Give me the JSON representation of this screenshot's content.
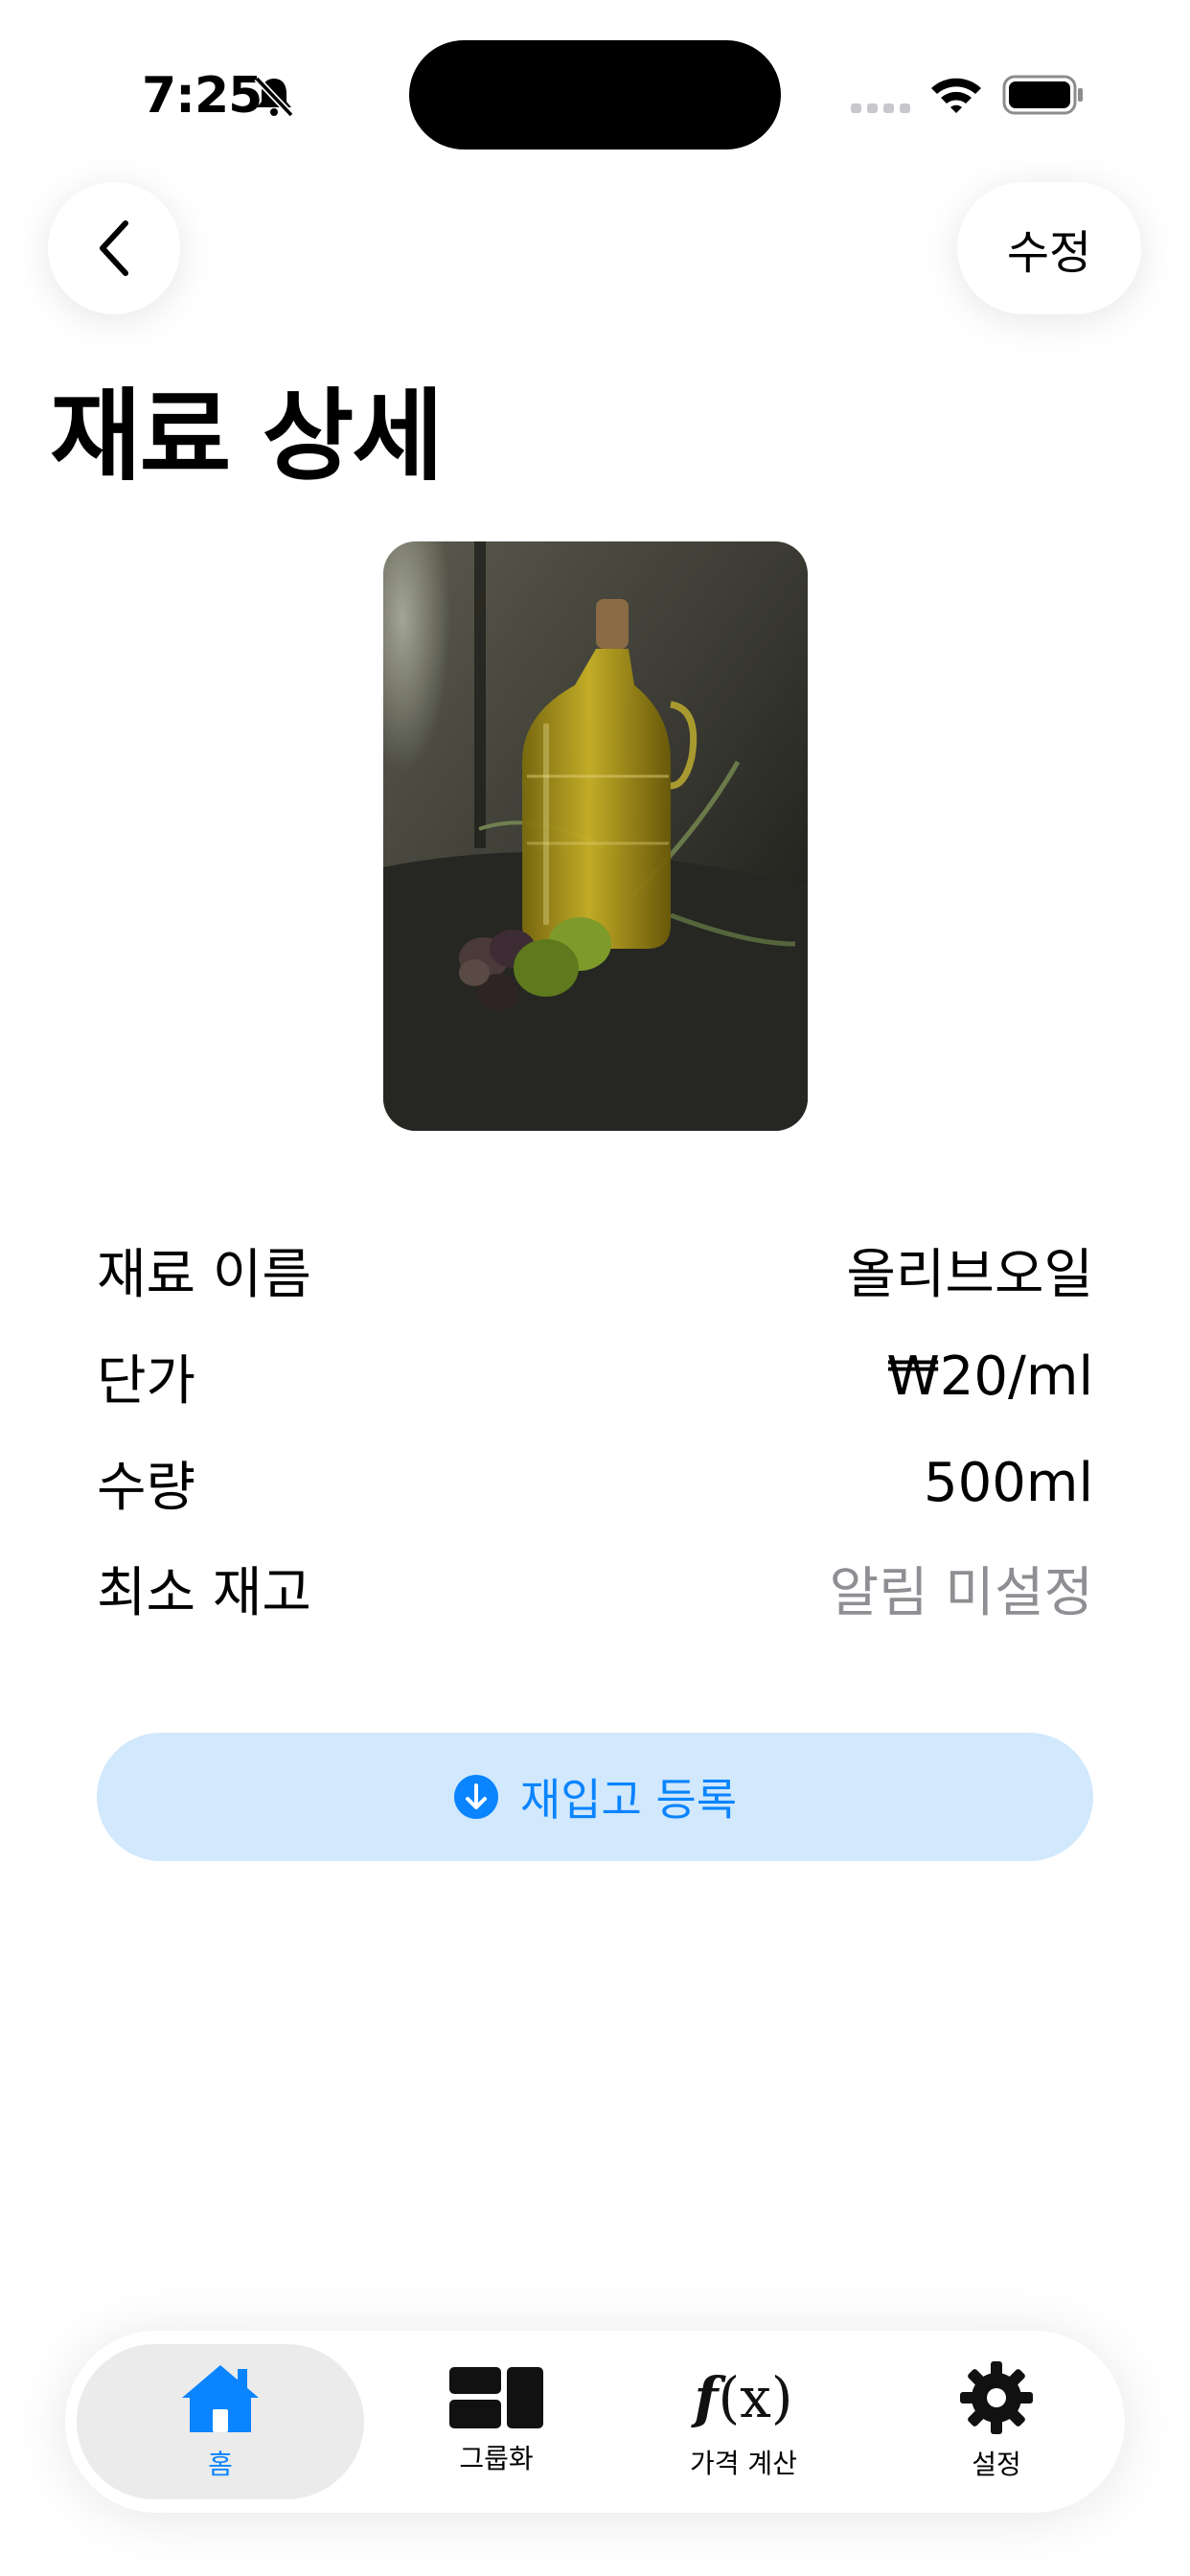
{
  "status_bar": {
    "time": "7:25"
  },
  "nav": {
    "edit_label": "수정"
  },
  "page": {
    "title": "재료 상세"
  },
  "details": [
    {
      "label": "재료 이름",
      "value": "올리브오일"
    },
    {
      "label": "단가",
      "value": "₩20/ml"
    },
    {
      "label": "수량",
      "value": "500ml"
    },
    {
      "label": "최소 재고",
      "value": "알림 미설정"
    }
  ],
  "restock": {
    "label": "재입고 등록"
  },
  "tabs": [
    {
      "label": "홈",
      "icon": "house-icon",
      "active": true
    },
    {
      "label": "그룹화",
      "icon": "grid-icon",
      "active": false
    },
    {
      "label": "가격 계산",
      "icon": "function-icon",
      "active": false
    },
    {
      "label": "설정",
      "icon": "gear-icon",
      "active": false
    }
  ],
  "colors": {
    "accent": "#0a84ff",
    "restock_bg": "#d1e8fd",
    "muted": "#8e8e93"
  }
}
